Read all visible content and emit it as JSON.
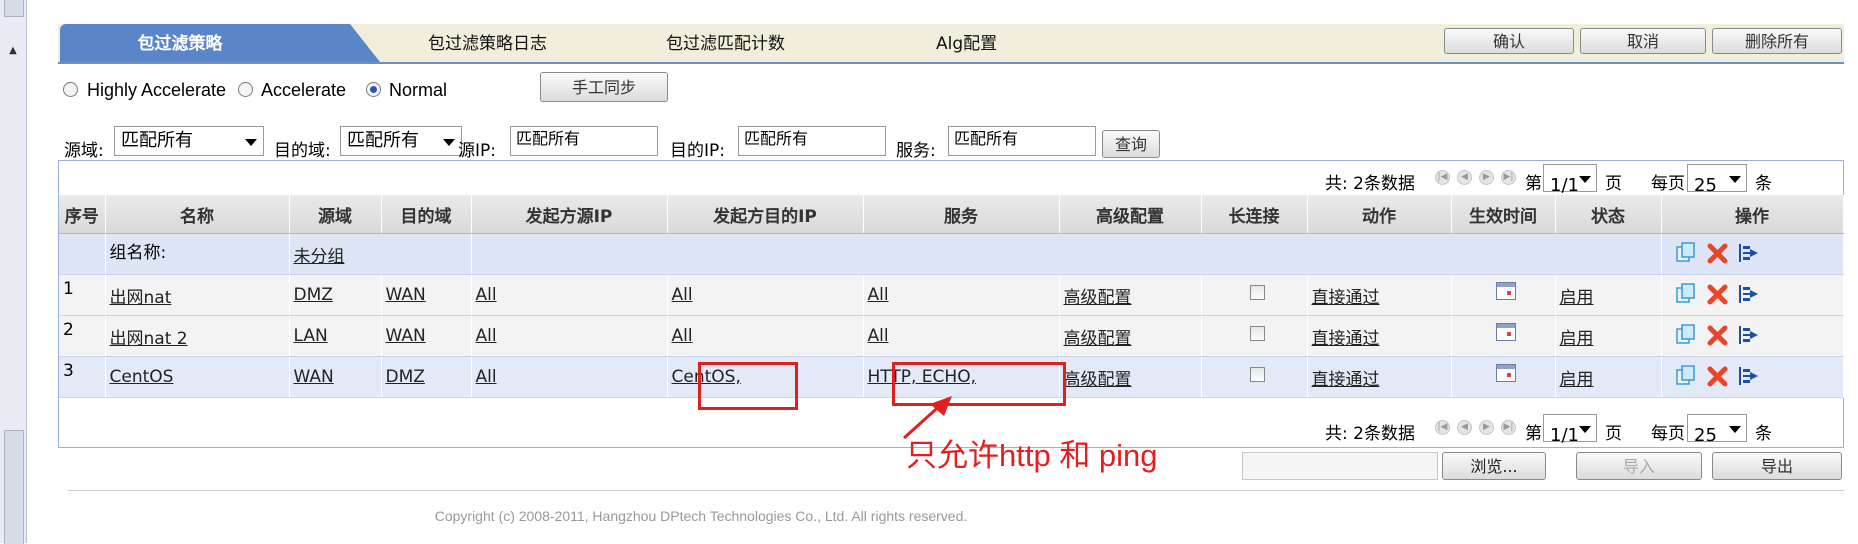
{
  "tabs": [
    "包过滤策略",
    "包过滤策略日志",
    "包过滤匹配计数",
    "Alg配置"
  ],
  "header_buttons": {
    "confirm": "确认",
    "cancel": "取消",
    "delete_all": "删除所有"
  },
  "modes": [
    {
      "label": "Highly Accelerate",
      "selected": false
    },
    {
      "label": "Accelerate",
      "selected": false
    },
    {
      "label": "Normal",
      "selected": true
    }
  ],
  "sync_button": "手工同步",
  "filters": {
    "src_zone_label": "源域:",
    "src_zone_value": "匹配所有",
    "dst_zone_label": "目的域:",
    "dst_zone_value": "匹配所有",
    "src_ip_label": "源IP:",
    "src_ip_value": "匹配所有",
    "dst_ip_label": "目的IP:",
    "dst_ip_value": "匹配所有",
    "service_label": "服务:",
    "service_value": "匹配所有",
    "query_button": "查询"
  },
  "pager": {
    "total": "共: 2条数据",
    "page_prefix": "第",
    "page_value": "1/1",
    "page_suffix": "页",
    "per_page_label": "每页",
    "per_page_value": "25",
    "per_page_suffix": "条"
  },
  "columns": [
    "序号",
    "名称",
    "源域",
    "目的域",
    "发起方源IP",
    "发起方目的IP",
    "服务",
    "高级配置",
    "长连接",
    "动作",
    "生效时间",
    "状态",
    "操作"
  ],
  "group": {
    "label": "组名称:",
    "name": "未分组"
  },
  "rows": [
    {
      "idx": "1",
      "name": "出网nat",
      "src": "DMZ",
      "dst": "WAN",
      "src_ip": "All",
      "dst_ip": "All",
      "service": "All",
      "adv": "高级配置",
      "action": "直接通过",
      "status": "启用"
    },
    {
      "idx": "2",
      "name": "出网nat 2",
      "src": "LAN",
      "dst": "WAN",
      "src_ip": "All",
      "dst_ip": "All",
      "service": "All",
      "adv": "高级配置",
      "action": "直接通过",
      "status": "启用"
    },
    {
      "idx": "3",
      "name": "CentOS",
      "src": "WAN",
      "dst": "DMZ",
      "src_ip": "All",
      "dst_ip": "CentOS,",
      "service": "HTTP, ECHO,",
      "adv": "高级配置",
      "action": "直接通过",
      "status": "启用"
    }
  ],
  "annotation": "只允许http  和 ping",
  "bottom_buttons": {
    "browse": "浏览...",
    "import": "导入",
    "export": "导出"
  },
  "copyright": "Copyright (c) 2008-2011, Hangzhou DPtech Technologies Co., Ltd. All rights reserved.",
  "colors": {
    "tab_active": "#5a86c9",
    "tab_bar": "#f1efdc",
    "annotation_red": "#e21e1e"
  },
  "icons": [
    "copy-icon",
    "delete-icon",
    "move-icon",
    "calendar-icon"
  ]
}
